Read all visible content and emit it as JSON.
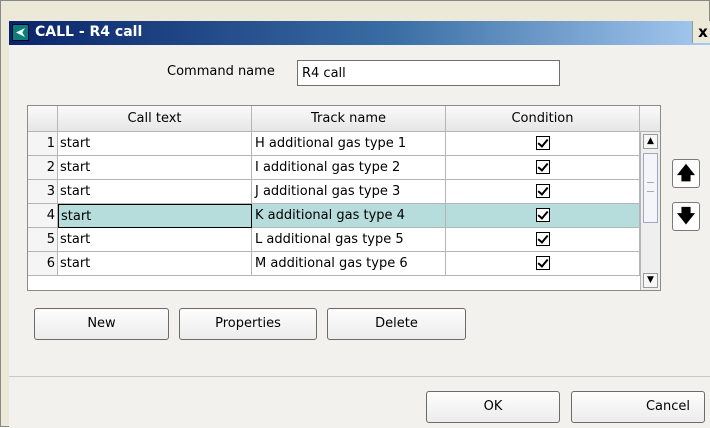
{
  "window": {
    "title": "CALL - R4 call",
    "close_label": "x"
  },
  "form": {
    "command_name_label": "Command name",
    "command_name_value": "R4 call"
  },
  "table": {
    "headers": [
      "",
      "Call text",
      "Track name",
      "Condition"
    ],
    "rows": [
      {
        "num": "1",
        "call_text": "start",
        "track_name": "H additional gas type 1",
        "condition": true
      },
      {
        "num": "2",
        "call_text": "start",
        "track_name": "I additional gas type 2",
        "condition": true
      },
      {
        "num": "3",
        "call_text": "start",
        "track_name": "J additional gas type 3",
        "condition": true
      },
      {
        "num": "4",
        "call_text": "start",
        "track_name": "K additional gas type 4",
        "condition": true
      },
      {
        "num": "5",
        "call_text": "start",
        "track_name": "L additional gas type 5",
        "condition": true
      },
      {
        "num": "6",
        "call_text": "start",
        "track_name": "M additional gas type 6",
        "condition": true
      }
    ],
    "selected_row": "4"
  },
  "buttons": {
    "new": "New",
    "properties": "Properties",
    "delete": "Delete",
    "ok": "OK",
    "cancel": "Cancel"
  },
  "icons": {
    "move_up": "up-arrow-icon",
    "move_down": "down-arrow-icon",
    "app": "app-logo-icon"
  }
}
